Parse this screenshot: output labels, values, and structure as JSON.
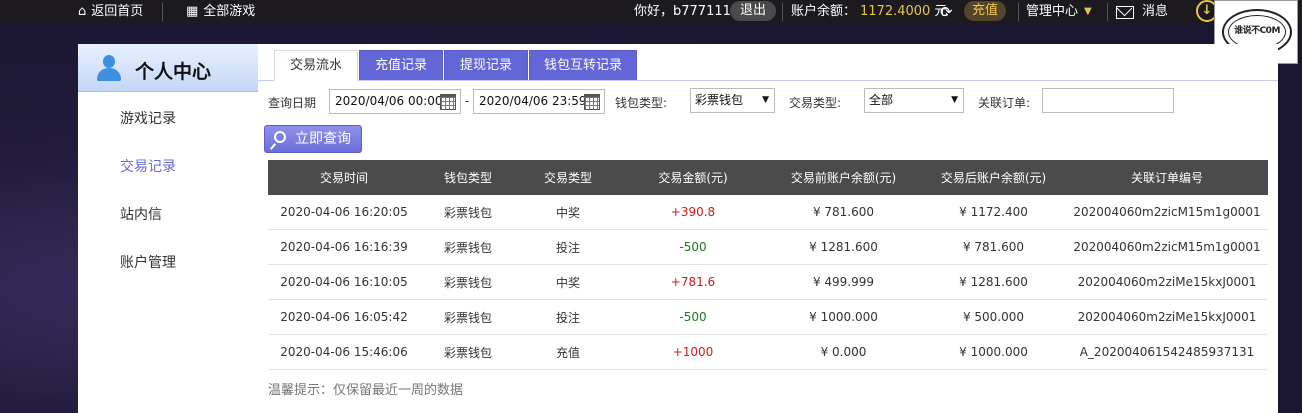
{
  "topbar": {
    "home_label": "返回首页",
    "games_label": "全部游戏",
    "greeting": "你好，b777111",
    "logout_label": "退出",
    "balance_label": "账户余额：",
    "balance_amount": "1172.4000",
    "balance_unit": "元",
    "recharge_label": "充值",
    "manage_label": "管理中心",
    "messages_label": "消息",
    "logo_text": "谁说不C0M"
  },
  "sidebar": {
    "title": "个人中心",
    "items": [
      {
        "label": "游戏记录"
      },
      {
        "label": "交易记录"
      },
      {
        "label": "站内信"
      },
      {
        "label": "账户管理"
      }
    ]
  },
  "tabs": [
    {
      "label": "交易流水"
    },
    {
      "label": "充值记录"
    },
    {
      "label": "提现记录"
    },
    {
      "label": "钱包互转记录"
    }
  ],
  "filters": {
    "date_label": "查询日期",
    "date_start": "2020/04/06 00:00",
    "date_sep": "-",
    "date_end": "2020/04/06 23:59",
    "wallet_label": "钱包类型:",
    "wallet_value": "彩票钱包",
    "trade_label": "交易类型:",
    "trade_value": "全部",
    "order_label": "关联订单:",
    "order_value": ""
  },
  "query_button": "立即查询",
  "table": {
    "headers": [
      "交易时间",
      "钱包类型",
      "交易类型",
      "交易金额(元)",
      "交易前账户余额(元)",
      "交易后账户余额(元)",
      "关联订单编号"
    ],
    "rows": [
      {
        "time": "2020-04-06 16:20:05",
        "wallet": "彩票钱包",
        "type": "中奖",
        "amount": "+390.8",
        "before": "¥ 781.600",
        "after": "¥ 1172.400",
        "order": "202004060m2zicM15m1g0001"
      },
      {
        "time": "2020-04-06 16:16:39",
        "wallet": "彩票钱包",
        "type": "投注",
        "amount": "-500",
        "before": "¥ 1281.600",
        "after": "¥ 781.600",
        "order": "202004060m2zicM15m1g0001"
      },
      {
        "time": "2020-04-06 16:10:05",
        "wallet": "彩票钱包",
        "type": "中奖",
        "amount": "+781.6",
        "before": "¥ 499.999",
        "after": "¥ 1281.600",
        "order": "202004060m2ziMe15kxJ0001"
      },
      {
        "time": "2020-04-06 16:05:42",
        "wallet": "彩票钱包",
        "type": "投注",
        "amount": "-500",
        "before": "¥ 1000.000",
        "after": "¥ 500.000",
        "order": "202004060m2ziMe15kxJ0001"
      },
      {
        "time": "2020-04-06 15:46:06",
        "wallet": "彩票钱包",
        "type": "充值",
        "amount": "+1000",
        "before": "¥ 0.000",
        "after": "¥ 1000.000",
        "order": "A_20200406154248593713​1"
      }
    ]
  },
  "tip": "温馨提示：仅保留最近一周的数据",
  "colors": {
    "accent": "#6366d7",
    "positive": "#d21b1b",
    "negative": "#1f7a1f",
    "balance": "#e8c44c",
    "table_header": "#4b4b4b"
  }
}
